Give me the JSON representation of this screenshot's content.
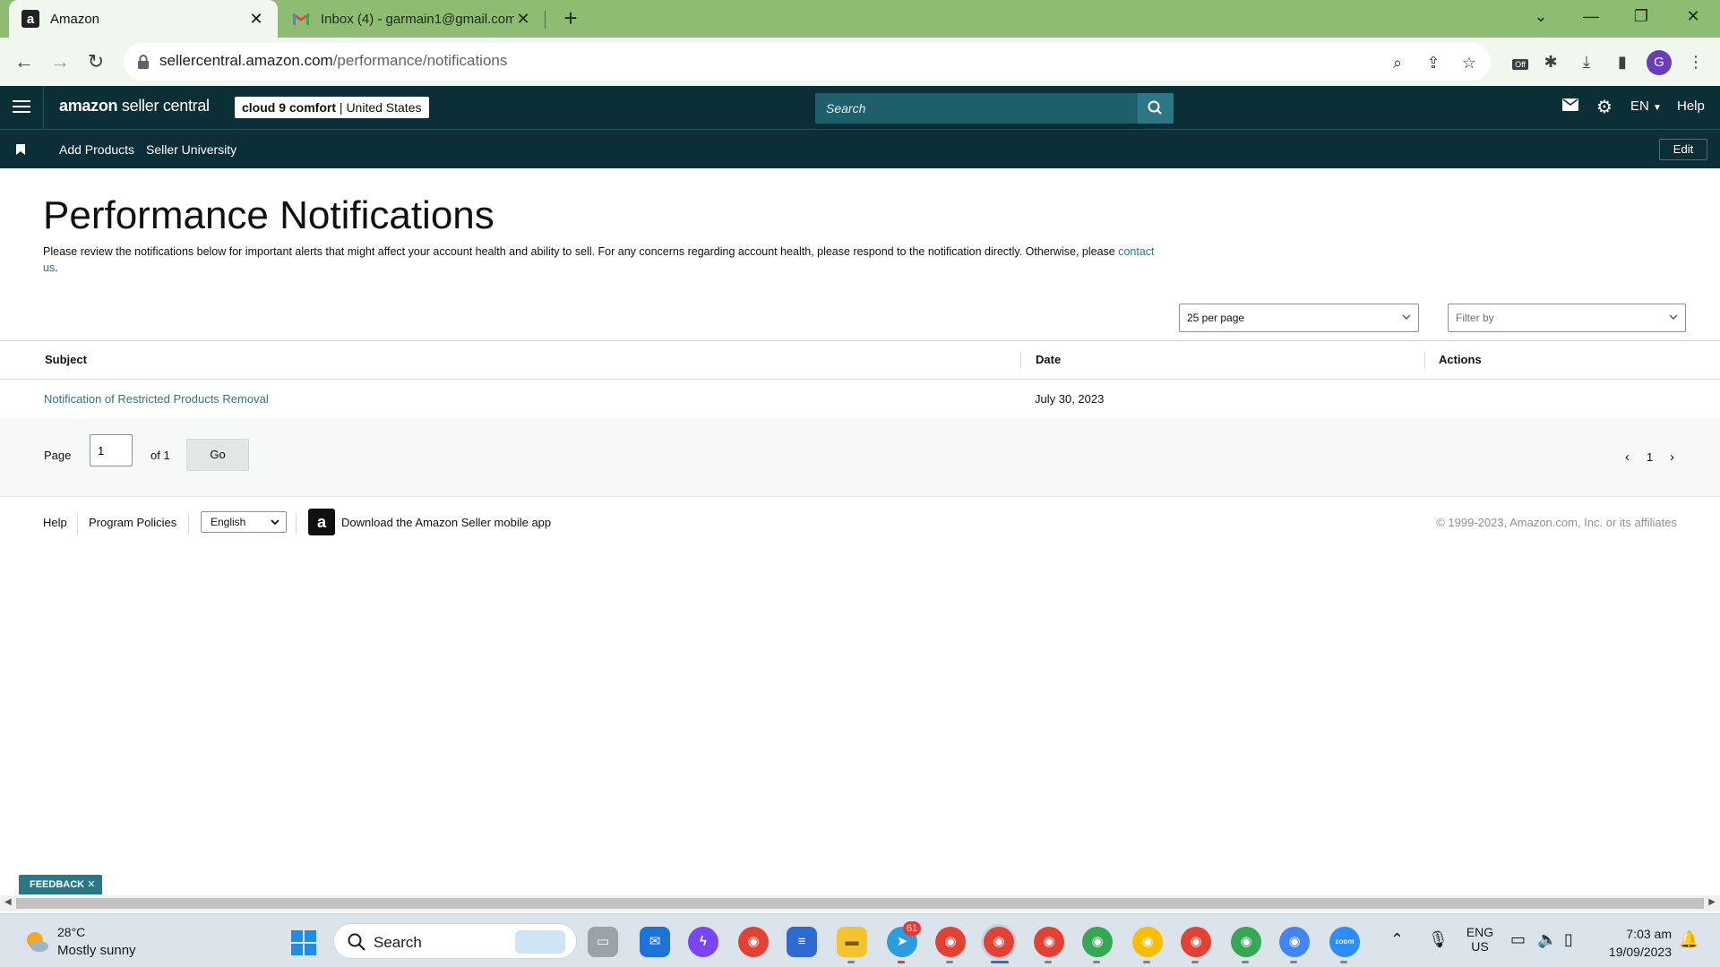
{
  "browser": {
    "tabs": [
      {
        "title": "Amazon",
        "favicon": "a"
      },
      {
        "title": "Inbox (4) - garmain1@gmail.com",
        "favicon": "M"
      }
    ],
    "url_host": "sellercentral.amazon.com",
    "url_path": "/performance/notifications",
    "profile_initial": "G",
    "ext_badge": "Off"
  },
  "header": {
    "logo_brand": "amazon",
    "logo_product": " seller central",
    "store_name": "cloud 9 comfort",
    "store_region": "United States",
    "search_placeholder": "Search",
    "language": "EN",
    "help": "Help"
  },
  "subnav": {
    "items": [
      "Add Products",
      "Seller University"
    ],
    "edit": "Edit"
  },
  "page": {
    "title": "Performance Notifications",
    "description_before": "Please review the notifications below for important alerts that might affect your account health and ability to sell. For any concerns regarding account health, please respond to the notification directly. Otherwise, please ",
    "description_link": "contact us",
    "description_after": ".",
    "per_page": "25 per page",
    "filter_placeholder": "Filter by"
  },
  "table": {
    "columns": [
      "Subject",
      "Date",
      "Actions"
    ],
    "rows": [
      {
        "subject": "Notification of Restricted Products Removal",
        "date": "July 30, 2023",
        "actions": ""
      }
    ]
  },
  "pagination": {
    "page_label": "Page",
    "page_value": "1",
    "of_label": "of 1",
    "go": "Go",
    "current": "1"
  },
  "footer": {
    "help": "Help",
    "policies": "Program Policies",
    "language": "English",
    "app_text": "Download the Amazon Seller mobile app",
    "copyright": "© 1999-2023, Amazon.com, Inc. or its affiliates"
  },
  "feedback": "FEEDBACK",
  "taskbar": {
    "temp": "28°C",
    "weather": "Mostly sunny",
    "search": "Search",
    "telegram_badge": "61",
    "lang_top": "ENG",
    "lang_bottom": "US",
    "time": "7:03 am",
    "date": "19/09/2023"
  },
  "colors": {
    "seller_header": "#0c2e36",
    "link": "#2a7886",
    "chrome_tabstrip": "#8dbc72"
  }
}
